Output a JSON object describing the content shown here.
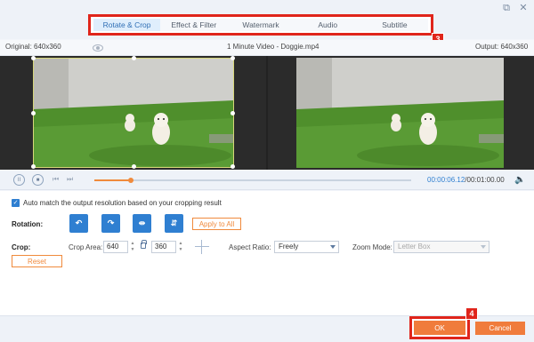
{
  "window": {
    "restore_glyph": "⧉",
    "close_glyph": "✕"
  },
  "tabs": [
    {
      "label": "Rotate & Crop",
      "active": true
    },
    {
      "label": "Effect & Filter",
      "active": false
    },
    {
      "label": "Watermark",
      "active": false
    },
    {
      "label": "Audio",
      "active": false
    },
    {
      "label": "Subtitle",
      "active": false
    }
  ],
  "annotations": {
    "tabs_badge": "3",
    "ok_badge": "4",
    "highlight_color": "#e0251b"
  },
  "infobar": {
    "original": "Original: 640x360",
    "file_name": "1 Minute Video - Doggie.mp4",
    "output": "Output: 640x360"
  },
  "playback": {
    "pause_glyph": "II",
    "stop_glyph": "■",
    "prev_glyph": "⏮",
    "next_glyph": "⏭",
    "progress": 0.115,
    "current_time": "00:00:06.12",
    "total_time": "/00:01:00.00",
    "volume_glyph": "🔈"
  },
  "settings": {
    "auto_match": {
      "checked": true,
      "label": "Auto match the output resolution based on your cropping result"
    },
    "rotation_label": "Rotation:",
    "rotation_buttons": [
      "↶",
      "↷",
      "⇹",
      "⇵"
    ],
    "apply_all": "Apply to All",
    "crop_label": "Crop:",
    "crop_area_label": "Crop Area:",
    "crop_width": "640",
    "crop_height": "360",
    "aspect_ratio_label": "Aspect Ratio:",
    "aspect_ratio_value": "Freely",
    "zoom_mode_label": "Zoom Mode:",
    "zoom_mode_value": "Letter Box",
    "reset": "Reset"
  },
  "footer": {
    "ok": "OK",
    "cancel": "Cancel"
  },
  "colors": {
    "accent_blue": "#2f7fd1",
    "accent_orange": "#f07c3c",
    "grass": "#4f8f2c",
    "wall": "#c9c9c6"
  }
}
